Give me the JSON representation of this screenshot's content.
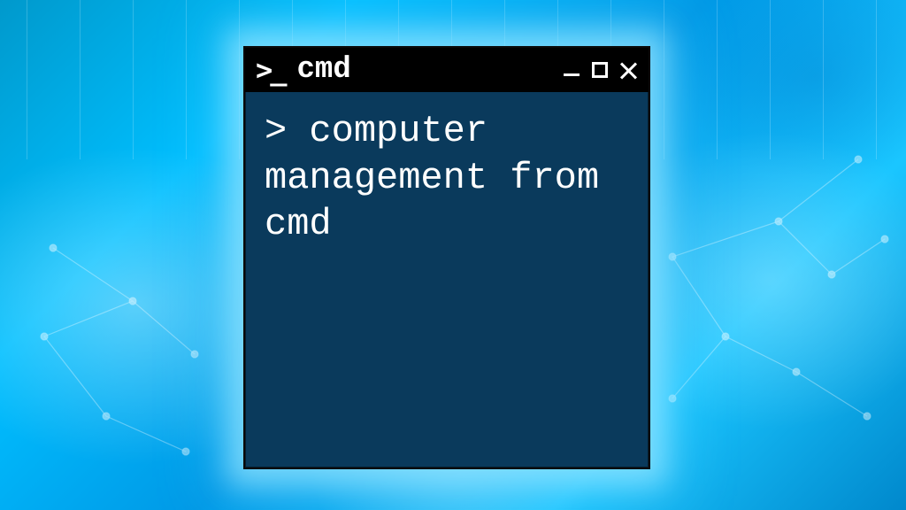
{
  "titlebar": {
    "prompt_symbol": ">_",
    "title": "cmd"
  },
  "terminal": {
    "prompt": "> ",
    "command_text": "computer management from cmd"
  }
}
